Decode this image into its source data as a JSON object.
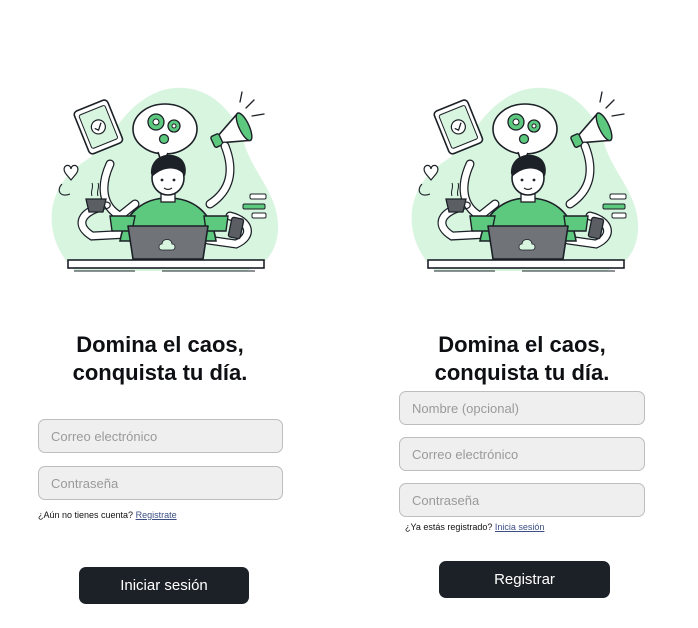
{
  "login": {
    "headline_line1": "Domina el caos,",
    "headline_line2": "conquista tu día.",
    "email_placeholder": "Correo electrónico",
    "password_placeholder": "Contraseña",
    "helper_text": "¿Aún no tienes cuenta?",
    "helper_link": "Registrate",
    "submit_label": "Iniciar sesión"
  },
  "register": {
    "headline_line1": "Domina el caos,",
    "headline_line2": "conquista tu día.",
    "name_placeholder": "Nombre (opcional)",
    "email_placeholder": "Correo electrónico",
    "password_placeholder": "Contraseña",
    "helper_text": "¿Ya estás registrado?",
    "helper_link": "Inicia sesión",
    "submit_label": "Registrar"
  },
  "colors": {
    "accent_green": "#5cc97e",
    "blob_green": "#d8f5e0",
    "button_dark": "#1c2027",
    "field_bg": "#efefef",
    "link_blue": "#3b4f84"
  },
  "icons": [
    "multitasking-illustration",
    "gear-icon",
    "megaphone-icon",
    "tablet-icon",
    "coffee-cup-icon",
    "heart-icon",
    "laptop-icon",
    "phone-icon"
  ]
}
